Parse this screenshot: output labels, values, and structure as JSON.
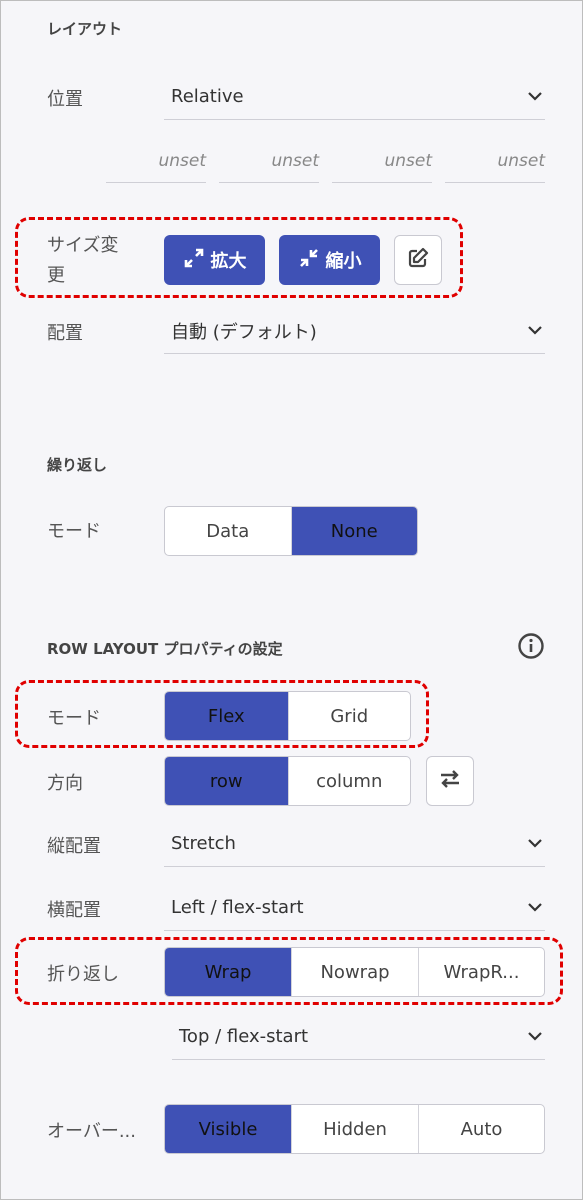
{
  "layout": {
    "title": "レイアウト",
    "position_label": "位置",
    "position_value": "Relative",
    "offsets": [
      "unset",
      "unset",
      "unset",
      "unset"
    ],
    "resize_label_line1": "サイズ変",
    "resize_label_line2": "更",
    "expand_label": "拡大",
    "shrink_label": "縮小",
    "align_label": "配置",
    "align_value": "自動 (デフォルト)"
  },
  "repeat": {
    "title": "繰り返し",
    "mode_label": "モード",
    "options": [
      "Data",
      "None"
    ],
    "active": "None"
  },
  "row_layout": {
    "title": "ROW LAYOUT プロパティの設定",
    "mode_label": "モード",
    "mode_options": [
      "Flex",
      "Grid"
    ],
    "mode_active": "Flex",
    "direction_label": "方向",
    "direction_options": [
      "row",
      "column"
    ],
    "direction_active": "row",
    "vertical_label": "縦配置",
    "vertical_value": "Stretch",
    "horizontal_label": "横配置",
    "horizontal_value": "Left / flex-start",
    "wrap_label": "折り返し",
    "wrap_options": [
      "Wrap",
      "Nowrap",
      "WrapR..."
    ],
    "wrap_active": "Wrap",
    "wrap_align_value": "Top / flex-start",
    "overflow_label": "オーバー...",
    "overflow_options": [
      "Visible",
      "Hidden",
      "Auto"
    ],
    "overflow_active": "Visible"
  },
  "colors": {
    "accent": "#3f51b5",
    "highlight": "#e00000",
    "background": "#f6f6f9"
  }
}
